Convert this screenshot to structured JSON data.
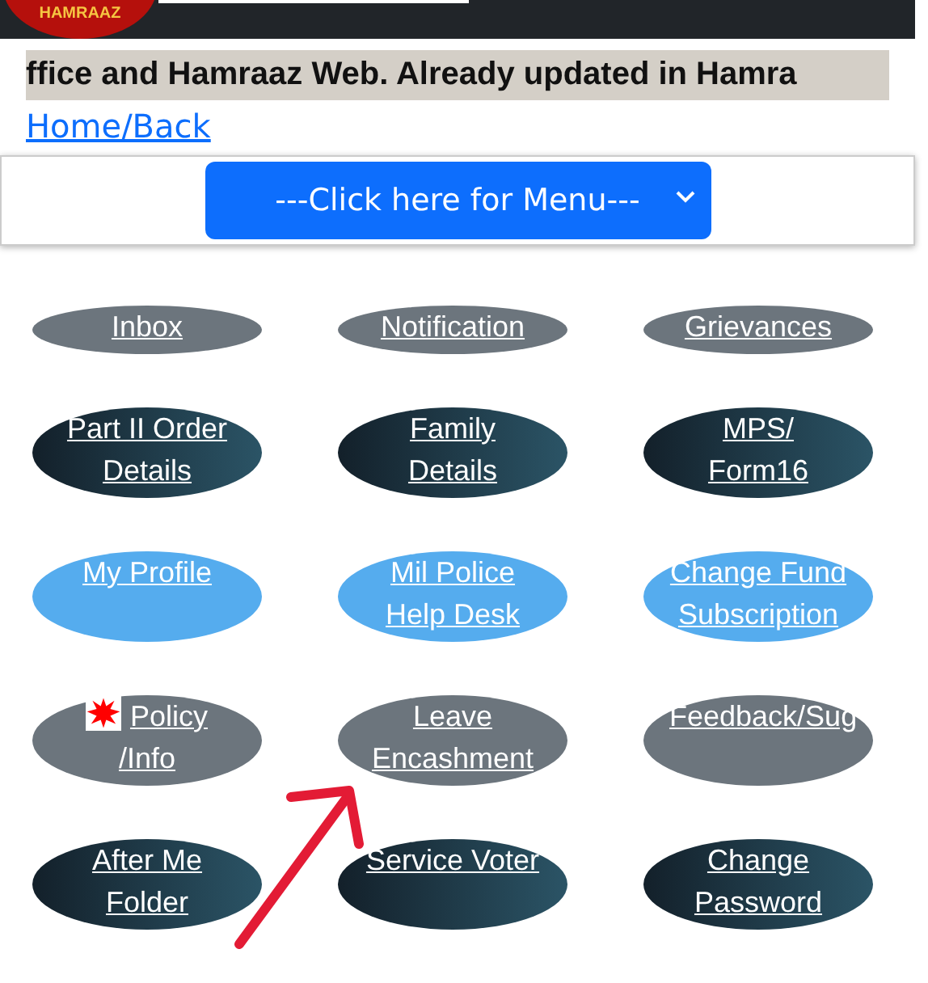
{
  "header": {
    "logo_text": "HAMRAAZ"
  },
  "ticker": "ffice and Hamraaz Web. Already updated in Hamra",
  "home_link": "Home/Back",
  "menu_select": {
    "label": "---Click here for Menu---"
  },
  "tiles": [
    {
      "label": "Inbox",
      "kind": "gray"
    },
    {
      "label": "Notification",
      "kind": "gray"
    },
    {
      "label": "Grievances",
      "kind": "gray"
    },
    {
      "label": "Part II Order Details",
      "kind": "dark"
    },
    {
      "label": "Family Details",
      "kind": "dark"
    },
    {
      "label": "MPS/ Form16",
      "kind": "dark"
    },
    {
      "label": "My Profile",
      "kind": "light"
    },
    {
      "label": "Mil Police Help Desk",
      "kind": "light"
    },
    {
      "label": "Change Fund Subscription",
      "kind": "light"
    },
    {
      "label": "Policy /Info",
      "kind": "gray",
      "new_badge": true
    },
    {
      "label": "Leave Encashment",
      "kind": "gray"
    },
    {
      "label": "Feedback/Sug",
      "kind": "gray"
    },
    {
      "label": "After Me Folder",
      "kind": "dark"
    },
    {
      "label": "Service Voter",
      "kind": "dark"
    },
    {
      "label": "Change Password",
      "kind": "dark"
    }
  ]
}
